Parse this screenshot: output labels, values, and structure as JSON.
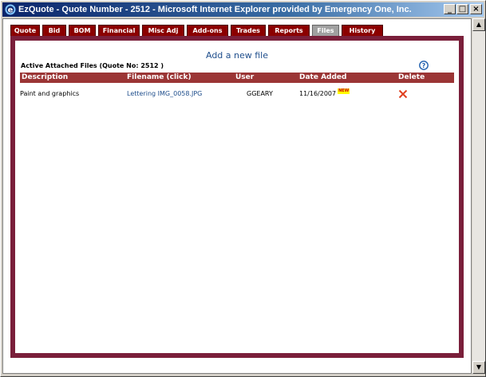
{
  "window": {
    "title": "EzQuote - Quote Number - 2512 - Microsoft Internet Explorer provided by Emergency One, Inc.",
    "controls": {
      "minimize": "_",
      "maximize": "□",
      "close": "×"
    }
  },
  "tabs": [
    {
      "label": "Quote"
    },
    {
      "label": "Bid"
    },
    {
      "label": "BOM"
    },
    {
      "label": "Financial"
    },
    {
      "label": "Misc Adj"
    },
    {
      "label": "Add-ons"
    },
    {
      "label": "Trades"
    },
    {
      "label": "Reports"
    },
    {
      "label": "Files",
      "active": true
    },
    {
      "label": "History"
    }
  ],
  "files": {
    "add_link": "Add a new file",
    "section_title": "Active Attached Files (Quote No: 2512 )",
    "columns": {
      "description": "Description",
      "filename": "Filename (click)",
      "user": "User",
      "date_added": "Date Added",
      "delete": "Delete"
    },
    "rows": [
      {
        "description": "Paint and graphics",
        "filename": "Lettering IMG_0058.JPG",
        "user": "GGEARY",
        "date_added": "11/16/2007",
        "badge": "NEW"
      }
    ]
  },
  "scrollbar": {
    "up": "▲",
    "down": "▼"
  },
  "icons": {
    "app": "ie-icon",
    "help": "help-question-icon",
    "delete": "delete-x-icon"
  },
  "colors": {
    "tab": "#8b0000",
    "tab_active": "#a0a0a0",
    "panel_border": "#7a1f3a",
    "table_header": "#9b3535",
    "link": "#1f4e8c",
    "badge_bg": "#ffff00",
    "delete": "#e04020"
  }
}
